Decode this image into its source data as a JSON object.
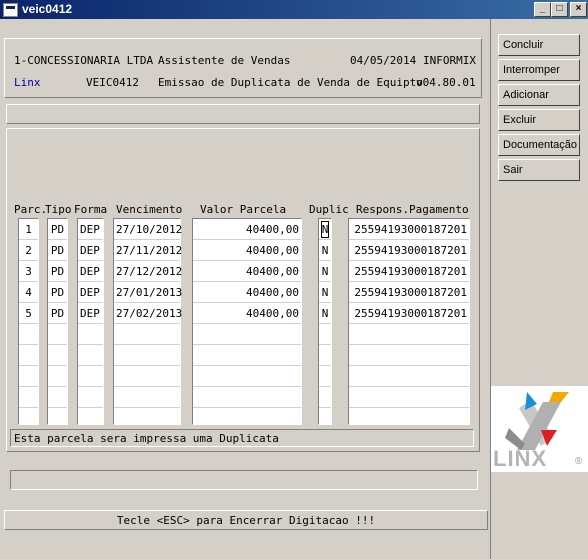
{
  "window": {
    "title": "veic0412"
  },
  "header": {
    "company": "1-CONCESSIONARIA LTDA",
    "role": "Assistente de Vendas",
    "date": "04/05/2014",
    "db": "INFORMIX",
    "brand": "Linx",
    "program": "VEIC0412",
    "description": "Emissao de Duplicata de Venda de Equipto",
    "version": "v04.80.01"
  },
  "sidebar": {
    "buttons": [
      {
        "label": "Concluir"
      },
      {
        "label": "Interromper"
      },
      {
        "label": "Adicionar"
      },
      {
        "label": "Excluir"
      },
      {
        "label": "Documentação"
      },
      {
        "label": "Sair"
      }
    ]
  },
  "table": {
    "columns": [
      "Parc.",
      "Tipo",
      "Forma",
      "Vencimento",
      "Valor Parcela",
      "Duplic",
      "Respons.Pagamento"
    ],
    "rows": [
      [
        "1",
        "PD",
        "DEP",
        "27/10/2012",
        "40400,00",
        "N",
        "25594193000187201"
      ],
      [
        "2",
        "PD",
        "DEP",
        "27/11/2012",
        "40400,00",
        "N",
        "25594193000187201"
      ],
      [
        "3",
        "PD",
        "DEP",
        "27/12/2012",
        "40400,00",
        "N",
        "25594193000187201"
      ],
      [
        "4",
        "PD",
        "DEP",
        "27/01/2013",
        "40400,00",
        "N",
        "25594193000187201"
      ],
      [
        "5",
        "PD",
        "DEP",
        "27/02/2013",
        "40400,00",
        "N",
        "25594193000187201"
      ]
    ]
  },
  "message": "Esta parcela sera impressa uma Duplicata",
  "footer": "Tecle <ESC> para Encerrar Digitacao !!!",
  "logo": {
    "text": "LINX",
    "mark": "®"
  }
}
